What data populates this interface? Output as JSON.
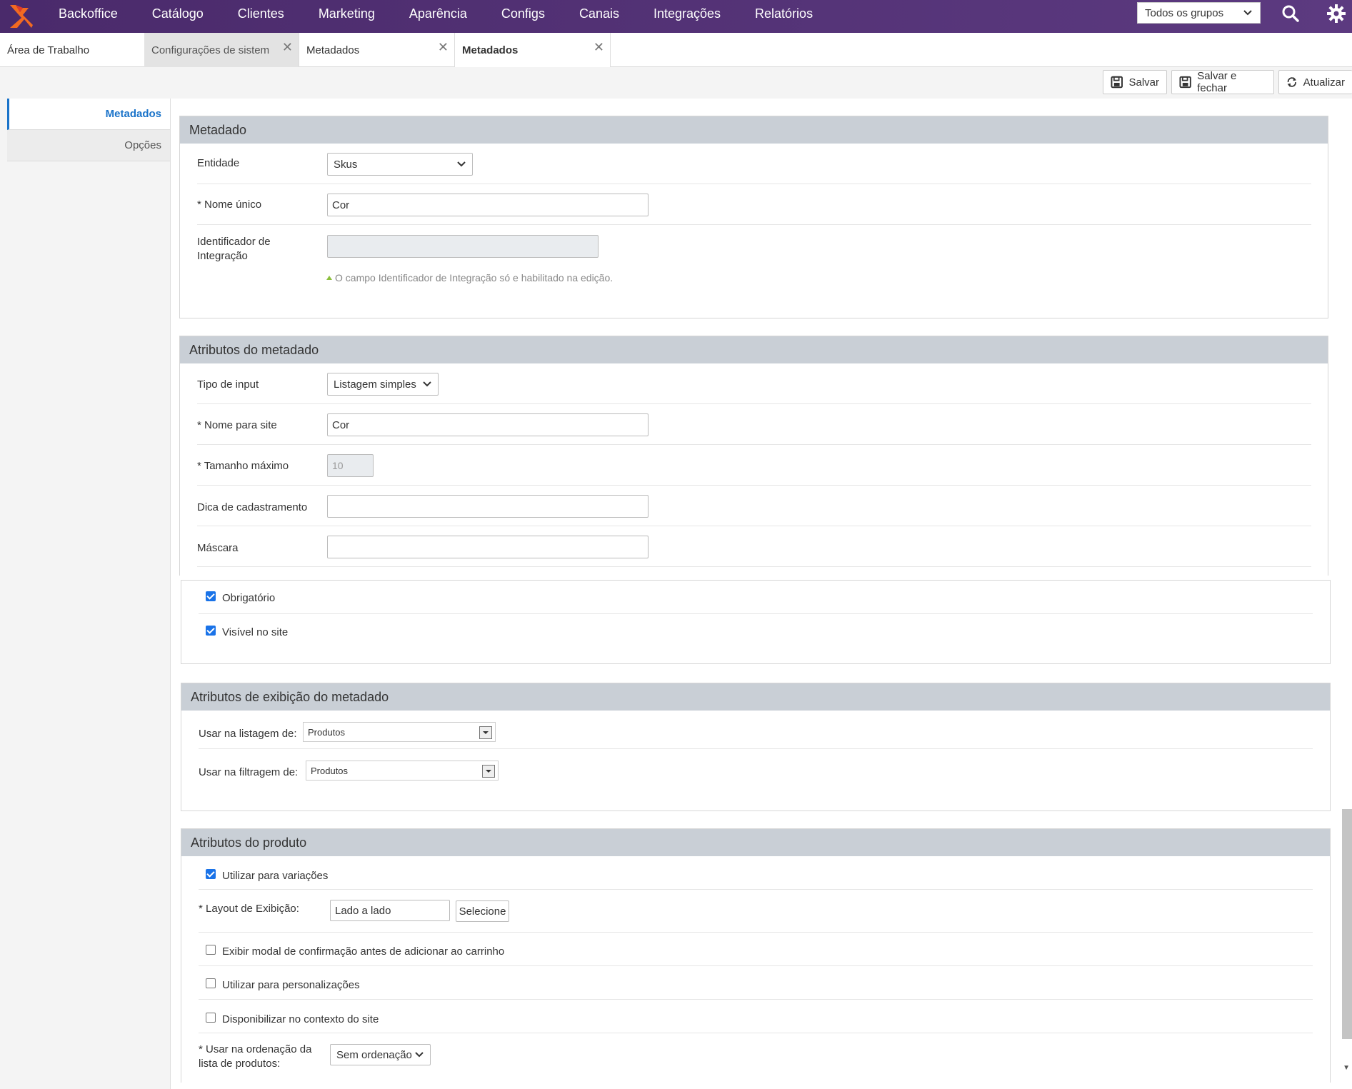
{
  "nav": {
    "items": [
      "Backoffice",
      "Catálogo",
      "Clientes",
      "Marketing",
      "Aparência",
      "Configs",
      "Canais",
      "Integrações",
      "Relatórios"
    ],
    "group_select": "Todos os grupos",
    "accent": "#4a2a6b"
  },
  "tabs": {
    "desktop": "Área de Trabalho",
    "system": "Configurações de sistema",
    "meta1": "Metadados",
    "meta2": "Metadados"
  },
  "toolbar": {
    "save": "Salvar",
    "save_close": "Salvar e fechar",
    "refresh": "Atualizar"
  },
  "leftmenu": {
    "metadados": "Metadados",
    "opcoes": "Opções"
  },
  "metadado": {
    "title": "Metadado",
    "entidade_label": "Entidade",
    "entidade_value": "Skus",
    "nome_unico_label": "* Nome único",
    "nome_unico_value": "Cor",
    "identificador_label": "Identificador de Integração",
    "identificador_value": "",
    "hint": "O campo Identificador de Integração só e habilitado na edição."
  },
  "atributos": {
    "title": "Atributos do metadado",
    "tipo_input_label": "Tipo de input",
    "tipo_input_value": "Listagem simples",
    "nome_site_label": "* Nome para site",
    "nome_site_value": "Cor",
    "tamanho_label": "* Tamanho máximo",
    "tamanho_value": "10",
    "dica_label": "Dica de cadastramento",
    "dica_value": "",
    "mascara_label": "Máscara",
    "mascara_value": "",
    "obrigatorio_label": "Obrigatório",
    "visivel_label": "Visível no site"
  },
  "exibicao": {
    "title": "Atributos de exibição do metadado",
    "listagem_label": "Usar na listagem de:",
    "listagem_value": "Produtos",
    "filtragem_label": "Usar na filtragem de:",
    "filtragem_value": "Produtos"
  },
  "produto": {
    "title": "Atributos do produto",
    "variacoes_label": "Utilizar para variações",
    "layout_label": "* Layout de Exibição:",
    "layout_value": "Lado a lado",
    "selecione": "Selecione",
    "modal_label": "Exibir modal de confirmação antes de adicionar ao carrinho",
    "personalizacoes_label": "Utilizar para personalizações",
    "contexto_label": "Disponibilizar no contexto do site",
    "ordenacao_label_1": "* Usar na ordenação da",
    "ordenacao_label_2": "lista de produtos:",
    "ordenacao_value": "Sem ordenação"
  }
}
